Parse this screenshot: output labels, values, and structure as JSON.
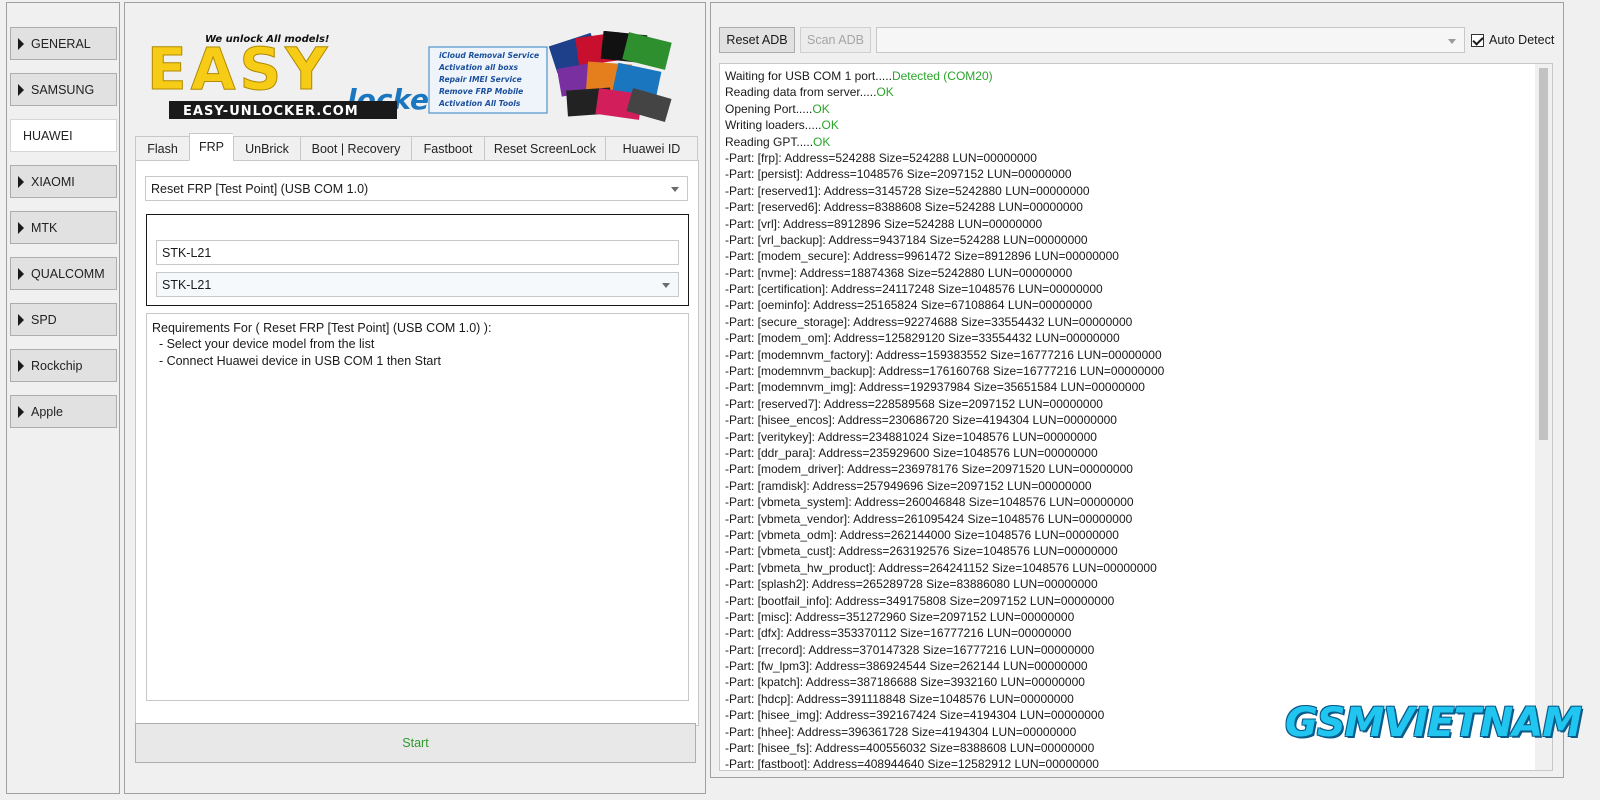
{
  "sidebar": {
    "items": [
      {
        "label": "GENERAL"
      },
      {
        "label": "SAMSUNG"
      },
      {
        "label": "HUAWEI",
        "active": true
      },
      {
        "label": "XIAOMI"
      },
      {
        "label": "MTK"
      },
      {
        "label": "QUALCOMM"
      },
      {
        "label": "SPD"
      },
      {
        "label": "Rockchip"
      },
      {
        "label": "Apple"
      }
    ]
  },
  "logo": {
    "tagline": "We unlock All models!",
    "brand_top": "EASY",
    "brand_sub": "locker",
    "url": "EASY-UNLOCKER.COM",
    "services": [
      "iCloud Removal Service",
      "Activation all boxs",
      "Repair IMEI Service",
      "Remove FRP Mobile",
      "Activation All Tools"
    ]
  },
  "tabs": [
    "Flash",
    "FRP",
    "UnBrick",
    "Boot | Recovery",
    "Fastboot",
    "Reset ScreenLock",
    "Huawei ID"
  ],
  "active_tab": "FRP",
  "frp": {
    "method_select": "Reset FRP [Test Point] (USB COM 1.0)",
    "model_input": "STK-L21",
    "model_select": "STK-L21",
    "requirements": "Requirements For ( Reset FRP [Test Point] (USB COM 1.0) ):\n  - Select your device model from the list\n  - Connect Huawei device in USB COM 1 then Start",
    "start_label": "Start"
  },
  "toolbar": {
    "reset_adb": "Reset ADB",
    "scan_adb": "Scan ADB",
    "auto_detect": "Auto Detect",
    "port_value": ""
  },
  "colors": {
    "ok": "#2aa52a",
    "watermark": "#21c6f0"
  },
  "log": [
    {
      "text": "Waiting for USB COM 1 port.....",
      "status": "Detected (COM20)"
    },
    {
      "text": "Reading data from server.....",
      "status": "OK"
    },
    {
      "text": "Opening Port.....",
      "status": "OK"
    },
    {
      "text": "Writing loaders.....",
      "status": "OK"
    },
    {
      "text": "Reading GPT.....",
      "status": "OK"
    },
    {
      "text": "-Part: [frp]: Address=524288 Size=524288 LUN=00000000"
    },
    {
      "text": "-Part: [persist]: Address=1048576 Size=2097152 LUN=00000000"
    },
    {
      "text": "-Part: [reserved1]: Address=3145728 Size=5242880 LUN=00000000"
    },
    {
      "text": "-Part: [reserved6]: Address=8388608 Size=524288 LUN=00000000"
    },
    {
      "text": "-Part: [vrl]: Address=8912896 Size=524288 LUN=00000000"
    },
    {
      "text": "-Part: [vrl_backup]: Address=9437184 Size=524288 LUN=00000000"
    },
    {
      "text": "-Part: [modem_secure]: Address=9961472 Size=8912896 LUN=00000000"
    },
    {
      "text": "-Part: [nvme]: Address=18874368 Size=5242880 LUN=00000000"
    },
    {
      "text": "-Part: [certification]: Address=24117248 Size=1048576 LUN=00000000"
    },
    {
      "text": "-Part: [oeminfo]: Address=25165824 Size=67108864 LUN=00000000"
    },
    {
      "text": "-Part: [secure_storage]: Address=92274688 Size=33554432 LUN=00000000"
    },
    {
      "text": "-Part: [modem_om]: Address=125829120 Size=33554432 LUN=00000000"
    },
    {
      "text": "-Part: [modemnvm_factory]: Address=159383552 Size=16777216 LUN=00000000"
    },
    {
      "text": "-Part: [modemnvm_backup]: Address=176160768 Size=16777216 LUN=00000000"
    },
    {
      "text": "-Part: [modemnvm_img]: Address=192937984 Size=35651584 LUN=00000000"
    },
    {
      "text": "-Part: [reserved7]: Address=228589568 Size=2097152 LUN=00000000"
    },
    {
      "text": "-Part: [hisee_encos]: Address=230686720 Size=4194304 LUN=00000000"
    },
    {
      "text": "-Part: [veritykey]: Address=234881024 Size=1048576 LUN=00000000"
    },
    {
      "text": "-Part: [ddr_para]: Address=235929600 Size=1048576 LUN=00000000"
    },
    {
      "text": "-Part: [modem_driver]: Address=236978176 Size=20971520 LUN=00000000"
    },
    {
      "text": "-Part: [ramdisk]: Address=257949696 Size=2097152 LUN=00000000"
    },
    {
      "text": "-Part: [vbmeta_system]: Address=260046848 Size=1048576 LUN=00000000"
    },
    {
      "text": "-Part: [vbmeta_vendor]: Address=261095424 Size=1048576 LUN=00000000"
    },
    {
      "text": "-Part: [vbmeta_odm]: Address=262144000 Size=1048576 LUN=00000000"
    },
    {
      "text": "-Part: [vbmeta_cust]: Address=263192576 Size=1048576 LUN=00000000"
    },
    {
      "text": "-Part: [vbmeta_hw_product]: Address=264241152 Size=1048576 LUN=00000000"
    },
    {
      "text": "-Part: [splash2]: Address=265289728 Size=83886080 LUN=00000000"
    },
    {
      "text": "-Part: [bootfail_info]: Address=349175808 Size=2097152 LUN=00000000"
    },
    {
      "text": "-Part: [misc]: Address=351272960 Size=2097152 LUN=00000000"
    },
    {
      "text": "-Part: [dfx]: Address=353370112 Size=16777216 LUN=00000000"
    },
    {
      "text": "-Part: [rrecord]: Address=370147328 Size=16777216 LUN=00000000"
    },
    {
      "text": "-Part: [fw_lpm3]: Address=386924544 Size=262144 LUN=00000000"
    },
    {
      "text": "-Part: [kpatch]: Address=387186688 Size=3932160 LUN=00000000"
    },
    {
      "text": "-Part: [hdcp]: Address=391118848 Size=1048576 LUN=00000000"
    },
    {
      "text": "-Part: [hisee_img]: Address=392167424 Size=4194304 LUN=00000000"
    },
    {
      "text": "-Part: [hhee]: Address=396361728 Size=4194304 LUN=00000000"
    },
    {
      "text": "-Part: [hisee_fs]: Address=400556032 Size=8388608 LUN=00000000"
    },
    {
      "text": "-Part: [fastboot]: Address=408944640 Size=12582912 LUN=00000000"
    }
  ],
  "watermark": "GSMVIETNAM"
}
